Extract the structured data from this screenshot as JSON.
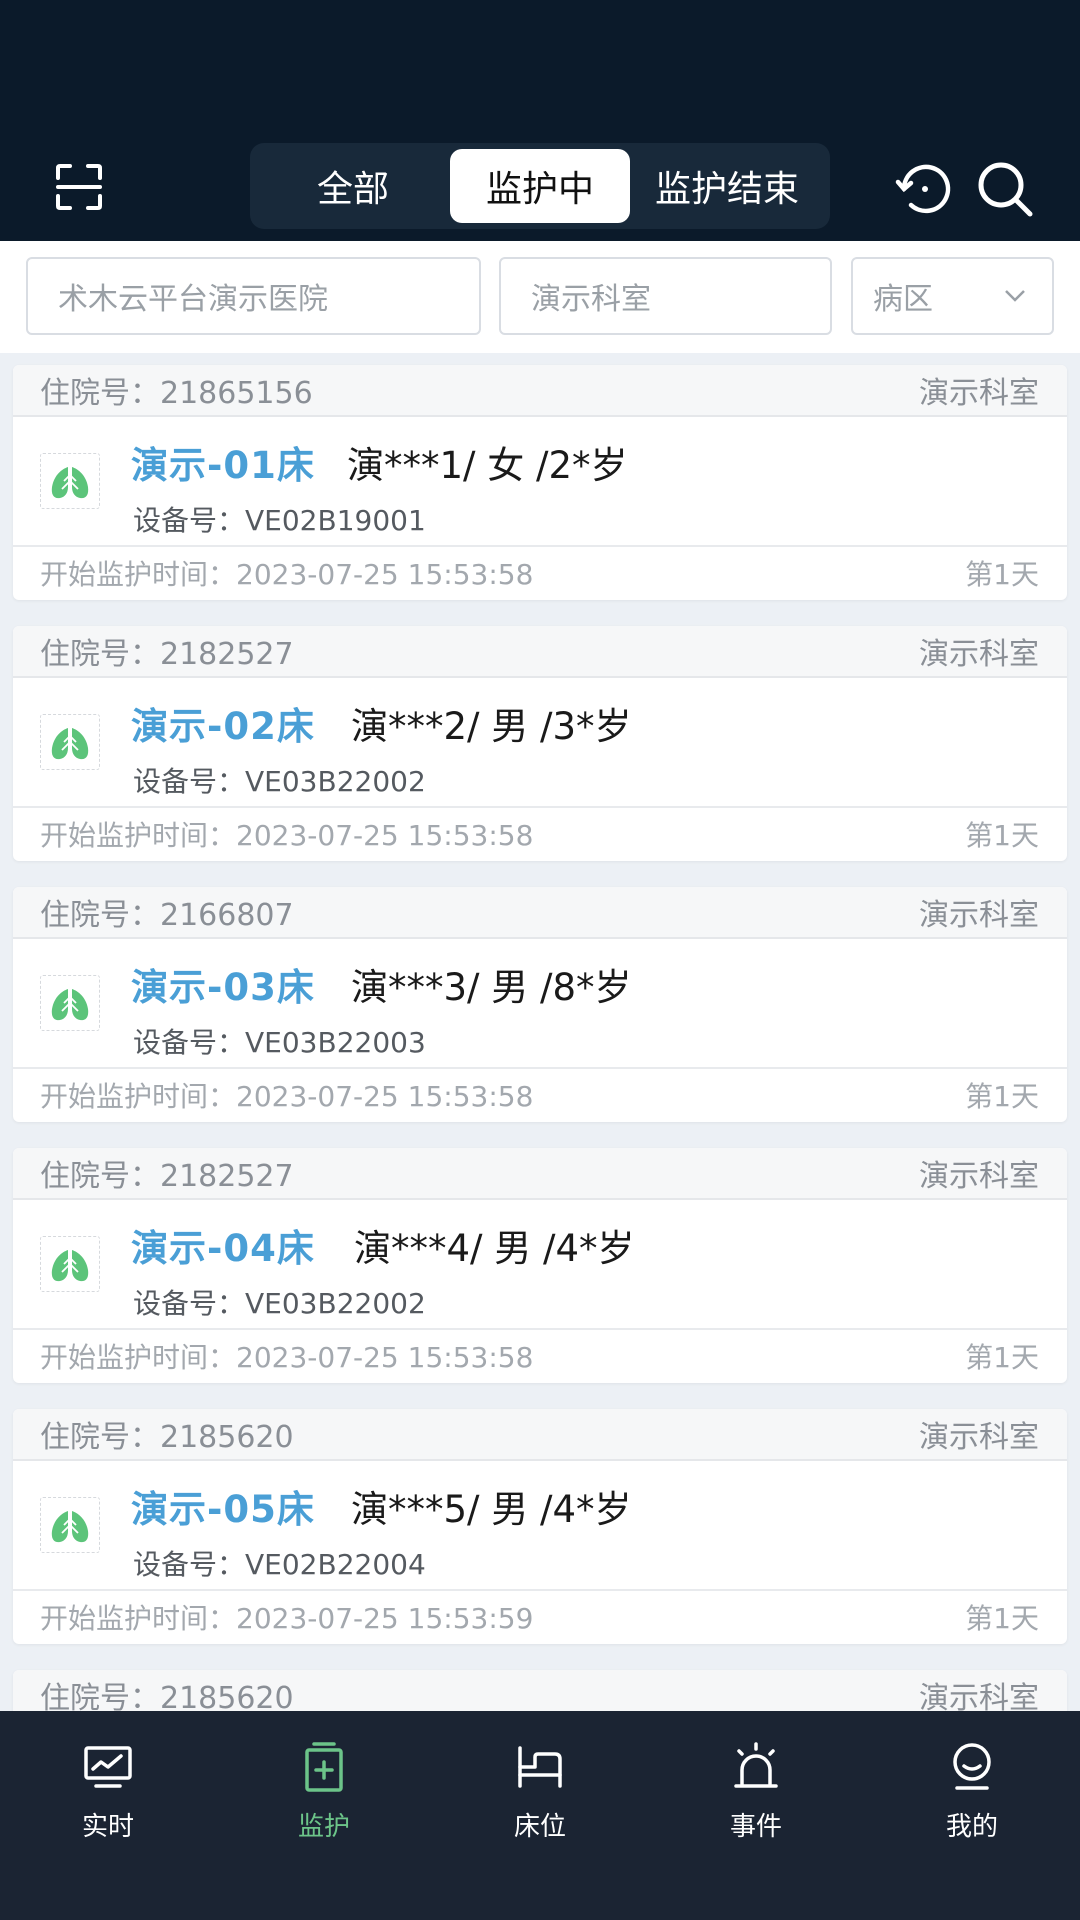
{
  "header": {
    "tabs": [
      {
        "label": "全部",
        "active": false
      },
      {
        "label": "监护中",
        "active": true
      },
      {
        "label": "监护结束",
        "active": false
      }
    ],
    "icons": {
      "scan": "scan-icon",
      "history": "history-icon",
      "search": "search-icon"
    }
  },
  "filters": {
    "hospital": "术木云平台演示医院",
    "department": "演示科室",
    "ward": "病区"
  },
  "labels": {
    "admission": "住院号：",
    "device": "设备号：",
    "start_time": "开始监护时间："
  },
  "patients": [
    {
      "admission_no": "21865156",
      "department": "演示科室",
      "bed": "演示-01床",
      "patient": "演***1/ 女 /2*岁",
      "device": "VE02B19001",
      "start_time": "2023-07-25 15:53:58",
      "day": "第1天"
    },
    {
      "admission_no": "2182527",
      "department": "演示科室",
      "bed": "演示-02床",
      "patient": "演***2/ 男 /3*岁",
      "device": "VE03B22002",
      "start_time": "2023-07-25 15:53:58",
      "day": "第1天"
    },
    {
      "admission_no": "2166807",
      "department": "演示科室",
      "bed": "演示-03床",
      "patient": "演***3/ 男 /8*岁",
      "device": "VE03B22003",
      "start_time": "2023-07-25 15:53:58",
      "day": "第1天"
    },
    {
      "admission_no": "2182527",
      "department": "演示科室",
      "bed": "演示-04床",
      "patient": "演***4/ 男 /4*岁",
      "device": "VE03B22002",
      "start_time": "2023-07-25 15:53:58",
      "day": "第1天"
    },
    {
      "admission_no": "2185620",
      "department": "演示科室",
      "bed": "演示-05床",
      "patient": "演***5/ 男 /4*岁",
      "device": "VE02B22004",
      "start_time": "2023-07-25 15:53:59",
      "day": "第1天"
    },
    {
      "admission_no": "2185620",
      "department": "演示科室",
      "bed": "",
      "patient": "",
      "device": "",
      "start_time": "",
      "day": ""
    }
  ],
  "nav": [
    {
      "label": "实时",
      "icon": "monitor-icon",
      "active": false
    },
    {
      "label": "监护",
      "icon": "medical-kit-icon",
      "active": true
    },
    {
      "label": "床位",
      "icon": "bed-icon",
      "active": false
    },
    {
      "label": "事件",
      "icon": "alarm-icon",
      "active": false
    },
    {
      "label": "我的",
      "icon": "profile-icon",
      "active": false
    }
  ],
  "colors": {
    "header_bg": "#0b1a2a",
    "accent_blue": "#4a9fd6",
    "lung_green": "#5cc47a",
    "nav_active": "#6cc489",
    "nav_bg": "#1b2433"
  }
}
